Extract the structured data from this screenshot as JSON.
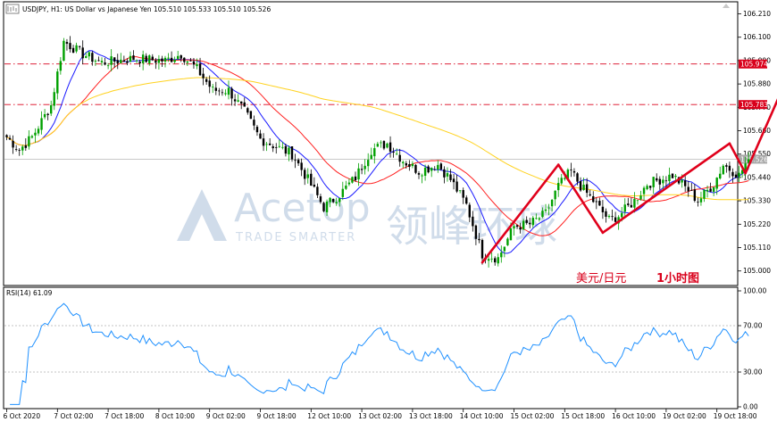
{
  "header": {
    "symbol_info": "USDJPY, H1:  US Dollar vs Japanese Yen  105.510 105.533 105.510 105.526"
  },
  "annotation": {
    "title_cn": "美元/日元",
    "timeframe_cn": "1小时图"
  },
  "watermark": {
    "brand": "Acetop",
    "brand_cn": "领峰环球",
    "slogan": "TRADE SMARTER"
  },
  "rsi_panel": {
    "label": "RSI(14) 61.09",
    "levels": [
      "100.00",
      "70.00",
      "30.00",
      "0.00"
    ],
    "level_values": [
      100,
      70,
      30,
      0
    ]
  },
  "price_axis": {
    "ticks": [
      "106.210",
      "106.100",
      "105.990",
      "105.880",
      "105.770",
      "105.660",
      "105.550",
      "105.440",
      "105.330",
      "105.220",
      "105.110",
      "105.000"
    ],
    "tick_values": [
      106.21,
      106.1,
      105.99,
      105.88,
      105.77,
      105.66,
      105.55,
      105.44,
      105.33,
      105.22,
      105.11,
      105.0
    ],
    "tags": [
      {
        "value": 105.974,
        "label": "105.974",
        "color": "#d9001b"
      },
      {
        "value": 105.783,
        "label": "105.783",
        "color": "#d9001b"
      },
      {
        "value": 105.526,
        "label": "105.526",
        "color": "#a8a8a8"
      }
    ]
  },
  "time_axis": {
    "labels": [
      "6 Oct 2020",
      "7 Oct 02:00",
      "7 Oct 18:00",
      "8 Oct 10:00",
      "9 Oct 02:00",
      "9 Oct 18:00",
      "12 Oct 10:00",
      "13 Oct 02:00",
      "13 Oct 18:00",
      "14 Oct 10:00",
      "15 Oct 02:00",
      "15 Oct 18:00",
      "16 Oct 10:00",
      "19 Oct 02:00",
      "19 Oct 18:00"
    ],
    "label_bars": [
      0,
      16,
      32,
      48,
      64,
      80,
      96,
      112,
      128,
      144,
      160,
      176,
      192,
      208,
      224
    ]
  },
  "chart_data": [
    {
      "type": "candlestick",
      "title": "USDJPY, H1: US Dollar vs Japanese Yen",
      "ylim": [
        104.94,
        106.25
      ],
      "horizontal_levels": [
        105.974,
        105.783
      ],
      "current_price": 105.526,
      "path_keypoints": [
        [
          0,
          105.63
        ],
        [
          4,
          105.57
        ],
        [
          8,
          105.63
        ],
        [
          14,
          105.78
        ],
        [
          18,
          106.08
        ],
        [
          24,
          106.02
        ],
        [
          30,
          105.98
        ],
        [
          40,
          106.0
        ],
        [
          50,
          105.99
        ],
        [
          55,
          106.02
        ],
        [
          60,
          105.95
        ],
        [
          65,
          105.85
        ],
        [
          70,
          105.85
        ],
        [
          75,
          105.75
        ],
        [
          80,
          105.62
        ],
        [
          90,
          105.55
        ],
        [
          95,
          105.43
        ],
        [
          100,
          105.3
        ],
        [
          105,
          105.36
        ],
        [
          110,
          105.44
        ],
        [
          115,
          105.57
        ],
        [
          120,
          105.6
        ],
        [
          125,
          105.52
        ],
        [
          130,
          105.47
        ],
        [
          136,
          105.5
        ],
        [
          140,
          105.43
        ],
        [
          145,
          105.31
        ],
        [
          150,
          105.08
        ],
        [
          155,
          105.06
        ],
        [
          160,
          105.21
        ],
        [
          165,
          105.22
        ],
        [
          170,
          105.27
        ],
        [
          174,
          105.4
        ],
        [
          178,
          105.47
        ],
        [
          181,
          105.4
        ],
        [
          185,
          105.33
        ],
        [
          190,
          105.24
        ],
        [
          193,
          105.26
        ],
        [
          198,
          105.33
        ],
        [
          202,
          105.41
        ],
        [
          206,
          105.43
        ],
        [
          210,
          105.45
        ],
        [
          215,
          105.38
        ],
        [
          218,
          105.33
        ],
        [
          223,
          105.41
        ],
        [
          226,
          105.5
        ],
        [
          231,
          105.45
        ],
        [
          234,
          105.53
        ]
      ],
      "moving_averages": [
        {
          "period": 10,
          "color": "#1a1aff"
        },
        {
          "period": 24,
          "color": "#ff2020"
        },
        {
          "period": 100,
          "color": "#ffd21f"
        }
      ],
      "trend_arrows": [
        {
          "from": [
            150,
            105.04
          ],
          "to": [
            174,
            105.5
          ]
        },
        {
          "from": [
            174,
            105.5
          ],
          "to": [
            188,
            105.18
          ]
        },
        {
          "from": [
            188,
            105.18
          ],
          "to": [
            228,
            105.6
          ]
        },
        {
          "from": [
            228,
            105.6
          ],
          "to": [
            233,
            105.46
          ]
        },
        {
          "from": [
            233,
            105.46
          ],
          "to": [
            248,
            105.97
          ]
        }
      ]
    },
    {
      "type": "line",
      "title": "RSI(14)",
      "ylim": [
        0,
        100
      ],
      "levels": [
        70,
        30
      ],
      "last_value": 61.09
    }
  ]
}
